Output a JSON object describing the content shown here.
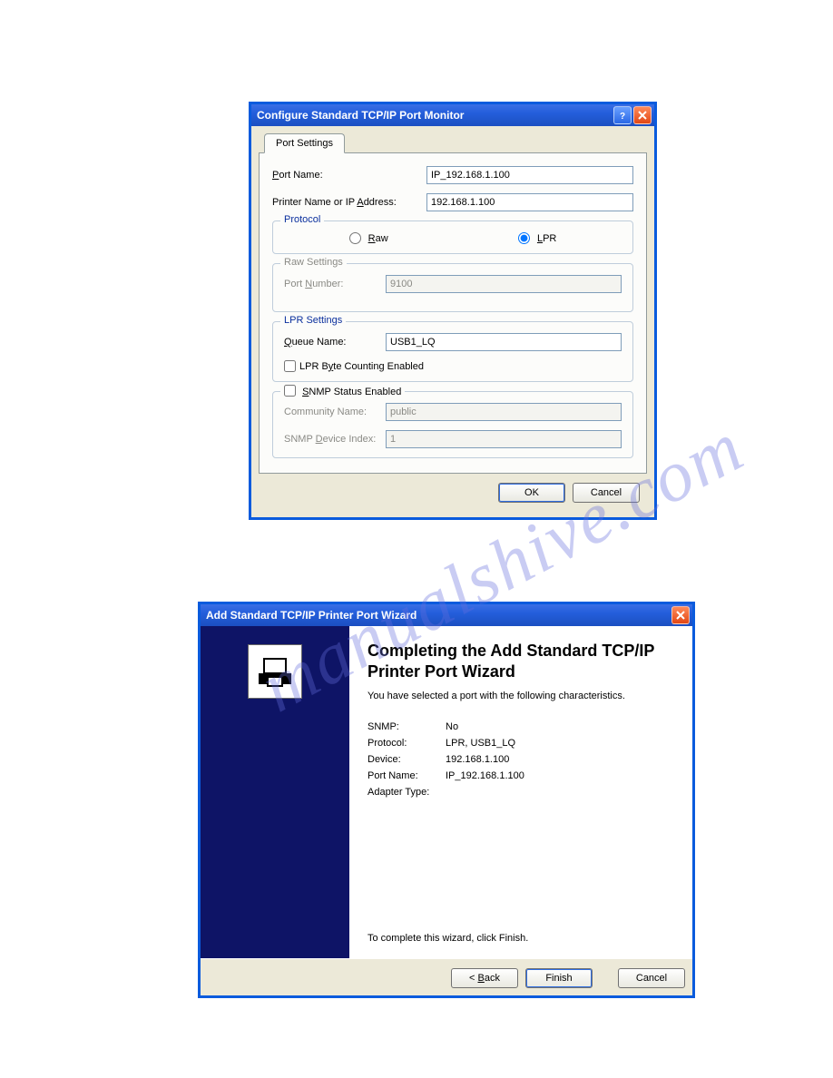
{
  "dialog1": {
    "title": "Configure Standard TCP/IP Port Monitor",
    "tab_label": "Port Settings",
    "port_name_label": "Port Name:",
    "port_name_value": "IP_192.168.1.100",
    "addr_label": "Printer Name or IP Address:",
    "addr_value": "192.168.1.100",
    "protocol_legend": "Protocol",
    "raw_label": "Raw",
    "lpr_label": "LPR",
    "raw_legend": "Raw Settings",
    "raw_port_label": "Port Number:",
    "raw_port_value": "9100",
    "lpr_legend": "LPR Settings",
    "queue_label": "Queue Name:",
    "queue_value": "USB1_LQ",
    "lpr_byte_label": "LPR Byte Counting Enabled",
    "snmp_legend": "SNMP Status Enabled",
    "community_label": "Community Name:",
    "community_value": "public",
    "devindex_label": "SNMP Device Index:",
    "devindex_value": "1",
    "ok": "OK",
    "cancel": "Cancel"
  },
  "dialog2": {
    "title": "Add Standard TCP/IP Printer Port Wizard",
    "heading": "Completing the Add Standard TCP/IP Printer Port Wizard",
    "intro": "You have selected a port with the following characteristics.",
    "rows": {
      "snmp_k": "SNMP:",
      "snmp_v": "No",
      "proto_k": "Protocol:",
      "proto_v": "LPR, USB1_LQ",
      "device_k": "Device:",
      "device_v": "192.168.1.100",
      "port_k": "Port Name:",
      "port_v": "IP_192.168.1.100",
      "adapter_k": "Adapter Type:",
      "adapter_v": ""
    },
    "outro": "To complete this wizard, click Finish.",
    "back": "< Back",
    "finish": "Finish",
    "cancel": "Cancel"
  }
}
